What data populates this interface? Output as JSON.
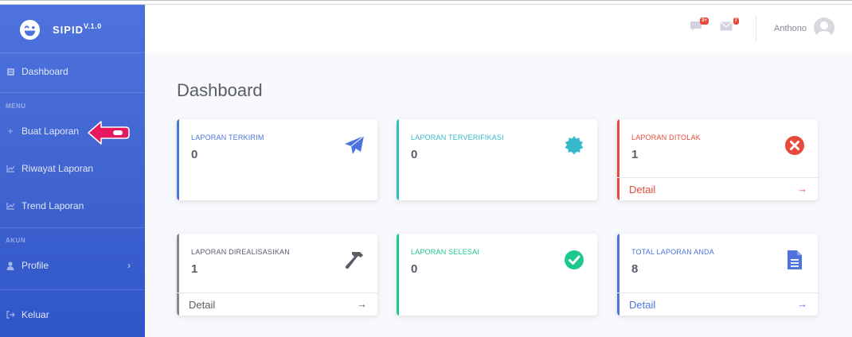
{
  "brand": {
    "name": "SIPID",
    "version": "V.1.0"
  },
  "sidebar": {
    "items": [
      {
        "label": "Dashboard",
        "icon": "dashboard-icon"
      },
      {
        "label": "Buat Laporan",
        "icon": "plus-icon"
      },
      {
        "label": "Riwayat Laporan",
        "icon": "chart-line-icon"
      },
      {
        "label": "Trend Laporan",
        "icon": "chart-line-icon"
      },
      {
        "label": "Profile",
        "icon": "user-icon"
      },
      {
        "label": "Keluar",
        "icon": "sign-out-icon"
      }
    ],
    "headings": {
      "menu": "MENU",
      "akun": "AKUN"
    }
  },
  "topbar": {
    "alerts_badge": "3+",
    "messages_badge": "7",
    "user_name": "Anthono"
  },
  "main": {
    "title": "Dashboard",
    "cards": [
      {
        "label": "LAPORAN TERKIRIM",
        "value": "0",
        "color": "#4e73df",
        "icon": "paper-plane-icon"
      },
      {
        "label": "LAPORAN TERVERIFIKASI",
        "value": "0",
        "color": "#36b9cc",
        "icon": "certificate-icon"
      },
      {
        "label": "LAPORAN DITOLAK",
        "value": "1",
        "color": "#e74a3b",
        "icon": "times-circle-icon",
        "detail": "Detail"
      },
      {
        "label": "LAPORAN DIREALISASIKAN",
        "value": "1",
        "color": "#858796",
        "icon": "hammer-icon",
        "detail": "Detail"
      },
      {
        "label": "LAPORAN SELESAI",
        "value": "0",
        "color": "#1cc88a",
        "icon": "check-circle-icon"
      },
      {
        "label": "TOTAL LAPORAN ANDA",
        "value": "8",
        "color": "#4e73df",
        "icon": "file-icon",
        "detail": "Detail"
      }
    ]
  },
  "colors": {
    "primary": "#4e73df",
    "info": "#36b9cc",
    "danger": "#e74a3b",
    "secondary": "#858796",
    "success": "#1cc88a",
    "annotation": "#e6195f"
  }
}
